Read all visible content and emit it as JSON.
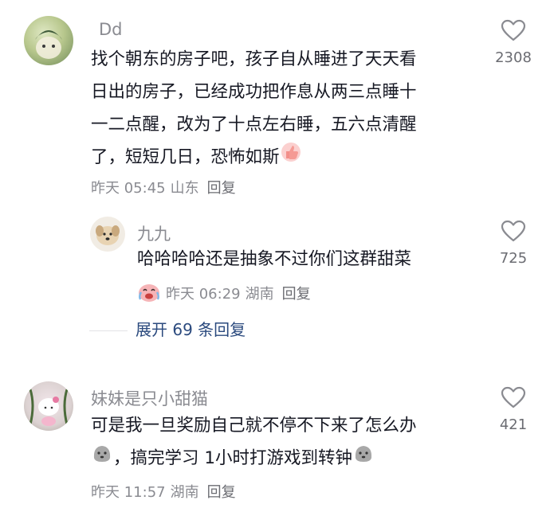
{
  "comments": [
    {
      "username": "Dd",
      "content_lines": [
        "找个朝东的房子吧，孩子自从睡进了天天看",
        "日出的房子，已经成功把作息从两三点睡十",
        "一二点醒，改为了十点左右睡，五六点清醒",
        "了，短短几日，恐怖如斯"
      ],
      "time": "昨天 05:45",
      "location": "山东",
      "reply_label": "回复",
      "likes": "2308"
    },
    {
      "username": "九九",
      "content_lines": [
        "哈哈哈哈还是抽象不过你们这群甜菜"
      ],
      "time": "昨天 06:29",
      "location": "湖南",
      "reply_label": "回复",
      "likes": "725"
    },
    {
      "username": "妹妹是只小甜猫",
      "content_lines": [
        "可是我一旦奖励自己就不停不下来了怎么办",
        "，搞完学习 1小时打游戏到转钟"
      ],
      "time": "昨天 11:57",
      "location": "湖南",
      "reply_label": "回复",
      "likes": "421"
    }
  ],
  "expand_replies": "展开 69 条回复",
  "icons": {
    "like": "heart-outline-icon",
    "thumb": "thumbs-up-emoji",
    "cry": "crying-laughing-emoji",
    "ghost": "grey-blob-emoji"
  },
  "colors": {
    "text": "#161823",
    "secondary": "#8a8b91",
    "link": "#2b4a7e"
  }
}
